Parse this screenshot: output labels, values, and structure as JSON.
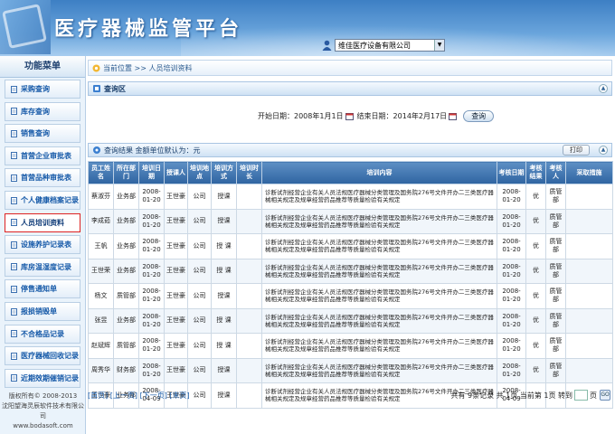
{
  "app": {
    "title": "医疗器械监管平台"
  },
  "company_select": {
    "value": "维佳医疗设备有限公司"
  },
  "sidebar": {
    "title": "功能菜单",
    "items": [
      {
        "label": "采购查询"
      },
      {
        "label": "库存查询"
      },
      {
        "label": "销售查询"
      },
      {
        "label": "首营企业审批表"
      },
      {
        "label": "首营品种审批表"
      },
      {
        "label": "个人健康档案记录"
      },
      {
        "label": "人员培训资料"
      },
      {
        "label": "设施养护记录表"
      },
      {
        "label": "库房温湿度记录"
      },
      {
        "label": "停售通知单"
      },
      {
        "label": "报损销毁单"
      },
      {
        "label": "不合格品记录"
      },
      {
        "label": "医疗器械回收记录"
      },
      {
        "label": "近期效期催销记录"
      }
    ],
    "footer_line1": "版权所有© 2008-2013",
    "footer_line2": "沈阳望海灵辰软件技术有限公司",
    "footer_line3": "www.bodasoft.com"
  },
  "breadcrumb": {
    "text": "当前位置 >> 人员培训资料"
  },
  "query": {
    "title": "查询区",
    "start_label": "开始日期：",
    "start_value": "2008年1月1日",
    "end_label": "结束日期：",
    "end_value": "2014年2月17日",
    "button": "查询"
  },
  "results": {
    "title": "查询结果  金额单位默认为：元",
    "print_button": "打印",
    "columns": [
      "员工姓名",
      "所在部门",
      "培训日期",
      "授课人",
      "培训地点",
      "培训方式",
      "培训时长",
      "培训内容",
      "考核日期",
      "考核结果",
      "考核人",
      "采取措施"
    ],
    "rows": [
      {
        "name": "蔡淑芬",
        "dept": "业务部",
        "date": "2008-01-20",
        "teacher": "王世豪",
        "place": "公司",
        "method": "授课",
        "hours": "",
        "content": "诊断试剂经营企业有关人员法规医疗器械分类管理及国务院276号文件开办二三类医疗器械相关规定及规章经营药品推荐等质量检验有关规定",
        "exam_date": "2008-01-20",
        "result": "优",
        "examiner": "质管部",
        "measure": ""
      },
      {
        "name": "李成茹",
        "dept": "业务部",
        "date": "2008-01-20",
        "teacher": "王世豪",
        "place": "公司",
        "method": "授课",
        "hours": "",
        "content": "诊断试剂经营企业有关人员法规医疗器械分类管理及国务院276号文件开办二三类医疗器械相关规定及规章经营药品推荐等质量检验有关规定",
        "exam_date": "2008-01-20",
        "result": "优",
        "examiner": "质管部",
        "measure": ""
      },
      {
        "name": "王帆",
        "dept": "业务部",
        "date": "2008-01-20",
        "teacher": "王世豪",
        "place": "公司",
        "method": "授 课",
        "hours": "",
        "content": "诊断试剂经营企业有关人员法规医疗器械分类管理及国务院276号文件开办二三类医疗器械相关规定及规章经营药品推荐等质量检验有关规定",
        "exam_date": "2008-01-20",
        "result": "优",
        "examiner": "质管部",
        "measure": ""
      },
      {
        "name": "王世荣",
        "dept": "业务部",
        "date": "2008-01-20",
        "teacher": "王世豪",
        "place": "公司",
        "method": "授 课",
        "hours": "",
        "content": "诊断试剂经营企业有关人员法规医疗器械分类管理及国务院276号文件开办二三类医疗器械相关规定及规章经营药品推荐等质量检验有关规定",
        "exam_date": "2008-01-20",
        "result": "优",
        "examiner": "质管部",
        "measure": ""
      },
      {
        "name": "杨文",
        "dept": "质管部",
        "date": "2008-01-20",
        "teacher": "王世豪",
        "place": "公司",
        "method": "授课",
        "hours": "",
        "content": "诊断试剂经营企业有关人员法规医疗器械分类管理及国务院276号文件开办二三类医疗器械相关规定及规章经营药品推荐等质量检验有关规定",
        "exam_date": "2008-01-20",
        "result": "优",
        "examiner": "质管部",
        "measure": ""
      },
      {
        "name": "张昱",
        "dept": "业务部",
        "date": "2008-01-20",
        "teacher": "王世豪",
        "place": "公司",
        "method": "授 课",
        "hours": "",
        "content": "诊断试剂经营企业有关人员法规医疗器械分类管理及国务院276号文件开办二三类医疗器械相关规定及规章经营药品推荐等质量检验有关规定",
        "exam_date": "2008-01-20",
        "result": "优",
        "examiner": "质管部",
        "measure": ""
      },
      {
        "name": "赵斌辉",
        "dept": "质管部",
        "date": "2008-01-20",
        "teacher": "王世豪",
        "place": "公司",
        "method": "授 课",
        "hours": "",
        "content": "诊断试剂经营企业有关人员法规医疗器械分类管理及国务院276号文件开办二三类医疗器械相关规定及规章经营药品推荐等质量检验有关规定",
        "exam_date": "2008-01-20",
        "result": "优",
        "examiner": "质管部",
        "measure": ""
      },
      {
        "name": "周秀华",
        "dept": "财务部",
        "date": "2008-01-20",
        "teacher": "王世豪",
        "place": "公司",
        "method": "授课",
        "hours": "",
        "content": "诊断试剂经营企业有关人员法规医疗器械分类管理及国务院276号文件开办二三类医疗器械相关规定及规章经营药品推荐等质量检验有关规定",
        "exam_date": "2008-01-20",
        "result": "优",
        "examiner": "质管部",
        "measure": ""
      },
      {
        "name": "王世豪",
        "dept": "业务部",
        "date": "2008-04-09",
        "teacher": "王世豪",
        "place": "公司",
        "method": "授课",
        "hours": "",
        "content": "诊断试剂经营企业有关人员法规医疗器械分类管理及国务院276号文件开办二三类医疗器械相关规定及规章经营药品推荐等质量检验有关规定",
        "exam_date": "2008-04-09",
        "result": "",
        "examiner": "",
        "measure": ""
      }
    ]
  },
  "pager": {
    "first": "[首页]",
    "prev": "[上一页]",
    "next": "[下一页]",
    "last": "[末页]",
    "summary": "共有 9条记录 共 1页 当前第 1页 转到",
    "page_suffix": "页",
    "go": "GO"
  },
  "colors": {
    "header_blue": "#3d7fc4",
    "table_header": "#2f64a1",
    "link": "#1559a8",
    "active_border": "#dd2222"
  }
}
